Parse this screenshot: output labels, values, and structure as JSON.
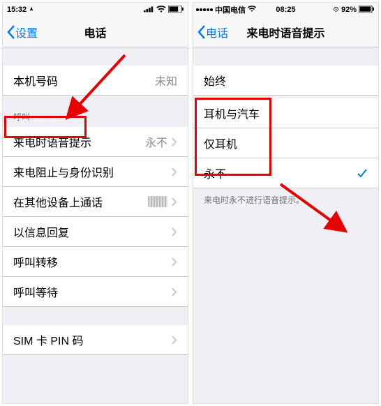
{
  "left": {
    "status": {
      "time": "15:32",
      "signal": "▮▮▮▮",
      "wifi": true,
      "battery": true
    },
    "nav": {
      "back": "设置",
      "title": "电话"
    },
    "section1": {
      "row_myNumber": {
        "label": "本机号码",
        "value": "未知"
      }
    },
    "section2_header": "呼叫",
    "section2": {
      "row_announce": {
        "label": "来电时语音提示",
        "value": "永不"
      },
      "row_block": {
        "label": "来电阻止与身份识别"
      },
      "row_other": {
        "label": "在其他设备上通话"
      },
      "row_respond": {
        "label": "以信息回复"
      },
      "row_forward": {
        "label": "呼叫转移"
      },
      "row_waiting": {
        "label": "呼叫等待"
      }
    },
    "section3": {
      "row_sim": {
        "label": "SIM 卡 PIN 码"
      }
    }
  },
  "right": {
    "status": {
      "carrier": "中国电信",
      "time": "08:25",
      "battery_pct": "92%"
    },
    "nav": {
      "back": "电话",
      "title": "来电时语音提示"
    },
    "section1": {
      "row_always": {
        "label": "始终"
      }
    },
    "section2": {
      "row_headcar": {
        "label": "耳机与汽车"
      },
      "row_head": {
        "label": "仅耳机"
      },
      "row_never": {
        "label": "永不",
        "checked": true
      }
    },
    "footer": "来电时永不进行语音提示。"
  },
  "colors": {
    "accent": "#007aff",
    "annotation": "#e60000"
  }
}
